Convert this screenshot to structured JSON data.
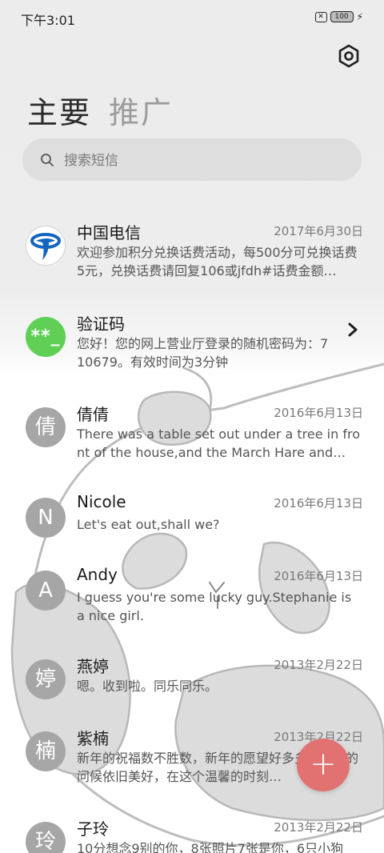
{
  "status_bar": {
    "time": "下午3:01",
    "sim_icon": "sim-off-icon",
    "battery_level": "100",
    "charging_icon": "bolt-icon"
  },
  "header": {
    "settings_icon": "settings-hexagon-icon",
    "tabs": [
      {
        "label": "主要",
        "active": true
      },
      {
        "label": "推广",
        "active": false
      }
    ]
  },
  "search": {
    "placeholder": "搜索短信",
    "icon": "search-icon"
  },
  "conversations": [
    {
      "name": "中国电信",
      "date": "2017年6月30日",
      "snippet": "欢迎参加积分兑换话费活动，每500分可兑换话费5元，兑换话费请回复106或jfdh#话费金额…",
      "avatar": "",
      "avatar_type": "china-telecom-logo"
    },
    {
      "name": "验证码",
      "date": "",
      "snippet": "您好！您的网上营业厅登录的随机密码为：710679。有效时间为3分钟",
      "avatar": "**_",
      "avatar_type": "green",
      "has_chevron": true
    },
    {
      "name": "倩倩",
      "date": "2016年6月13日",
      "snippet": "There was a table set out under a tree in front of the house,and the March Hare and…",
      "avatar": "倩",
      "avatar_type": "letter"
    },
    {
      "name": "Nicole",
      "date": "2016年6月13日",
      "snippet": "Let's eat out,shall we?",
      "avatar": "N",
      "avatar_type": "letter"
    },
    {
      "name": "Andy",
      "date": "2016年6月13日",
      "snippet": "I guess you're some lucky guy.Stephanie is a nice girl.",
      "avatar": "A",
      "avatar_type": "letter"
    },
    {
      "name": "燕婷",
      "date": "2013年2月22日",
      "snippet": "嗯。收到啦。同乐同乐。",
      "avatar": "婷",
      "avatar_type": "letter"
    },
    {
      "name": "紫楠",
      "date": "2013年2月22日",
      "snippet": "新年的祝福数不胜数，新年的愿望好多多，新年的问候依旧美好，在这个温馨的时刻…",
      "avatar": "楠",
      "avatar_type": "letter"
    },
    {
      "name": "子玲",
      "date": "2013年2月22日",
      "snippet": "10分想念9别的你，8张照片7张是你，6只小狗",
      "avatar": "玲",
      "avatar_type": "letter"
    }
  ],
  "fab": {
    "label": "+",
    "icon": "compose-plus-icon",
    "color": "#e27171"
  },
  "colors": {
    "verify_avatar": "#5fcf56",
    "avatar_gray": "#a6a6a6",
    "telecom_blue": "#1565c0"
  }
}
